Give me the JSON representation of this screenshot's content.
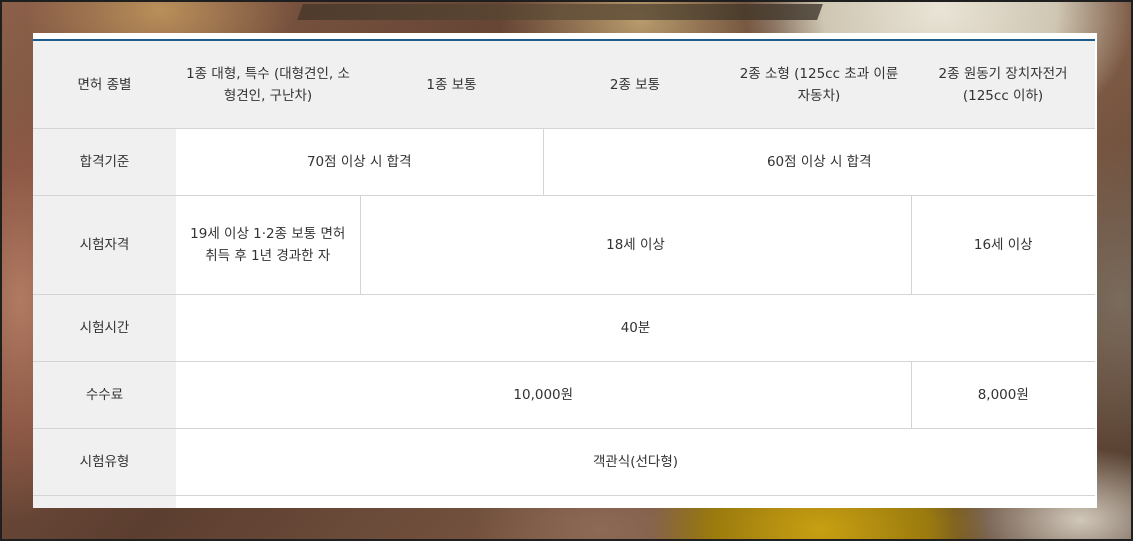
{
  "table": {
    "header": {
      "row_label": "면허 종별",
      "col1": "1종 대형, 특수 (대형견인, 소형견인, 구난차)",
      "col2": "1종 보통",
      "col3": "2종 보통",
      "col4": "2종 소형 (125cc 초과 이륜자동차)",
      "col5": "2종 원동기 장치자전거 (125cc 이하)"
    },
    "rows": {
      "pass": {
        "label": "합격기준",
        "a": "70점 이상 시 합격",
        "b": "60점 이상 시 합격"
      },
      "eligibility": {
        "label": "시험자격",
        "a": "19세 이상 1·2종 보통 면허 취득 후 1년 경과한 자",
        "b": "18세 이상",
        "c": "16세 이상"
      },
      "time": {
        "label": "시험시간",
        "a": "40분"
      },
      "fee": {
        "label": "수수료",
        "a": "10,000원",
        "b": "8,000원"
      },
      "type": {
        "label": "시험유형",
        "a": "객관식(선다형)"
      }
    }
  }
}
